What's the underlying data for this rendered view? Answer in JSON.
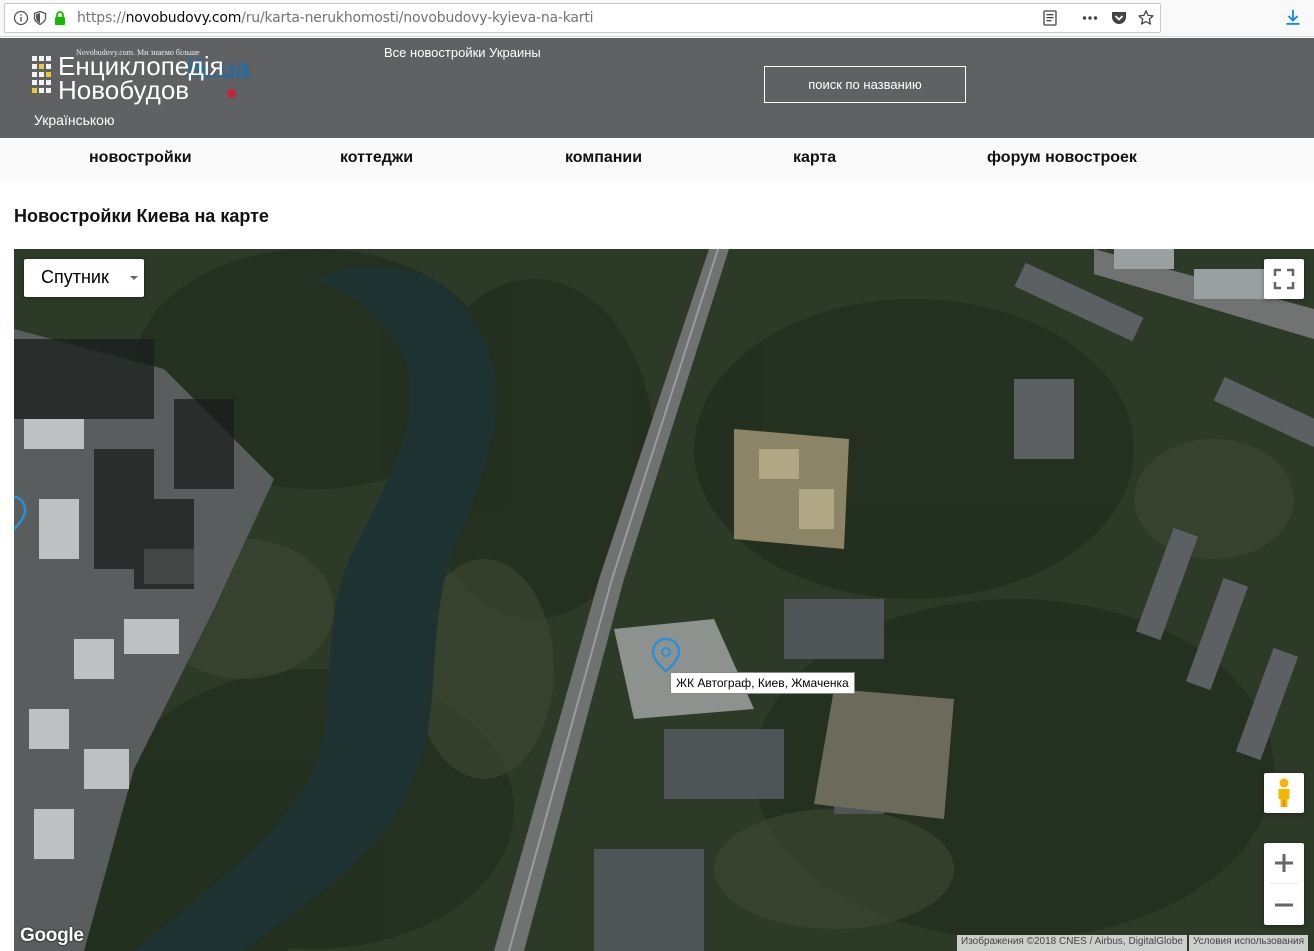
{
  "browser": {
    "url_prefix": "https://",
    "url_host": "novobudovy.com",
    "url_path": "/ru/karta-nerukhomosti/novobudovy-kyieva-na-karti"
  },
  "header": {
    "logo_tagline": "Novobudovy.com. Ми знаємо більше",
    "logo_line1": "Енциклопедія",
    "logo_line2": "Новобудов",
    "logo_overlay": "ik.ua",
    "lang_link": "Українською",
    "slogan": "Все новостройки Украины",
    "search_label": "поиск по названию"
  },
  "nav": {
    "items": [
      "новостройки",
      "коттеджи",
      "компании",
      "карта",
      "форум новостроек"
    ]
  },
  "page": {
    "title": "Новостройки Киева на карте"
  },
  "map": {
    "type_label": "Спутник",
    "marker_label": "ЖК Автограф, Киев, Жмаченка",
    "google_logo": "Google",
    "attribution": "Изображения ©2018 CNES / Airbus, DigitalGlobe",
    "terms": "Условия использования",
    "marker_color": "#2a8fd6"
  }
}
